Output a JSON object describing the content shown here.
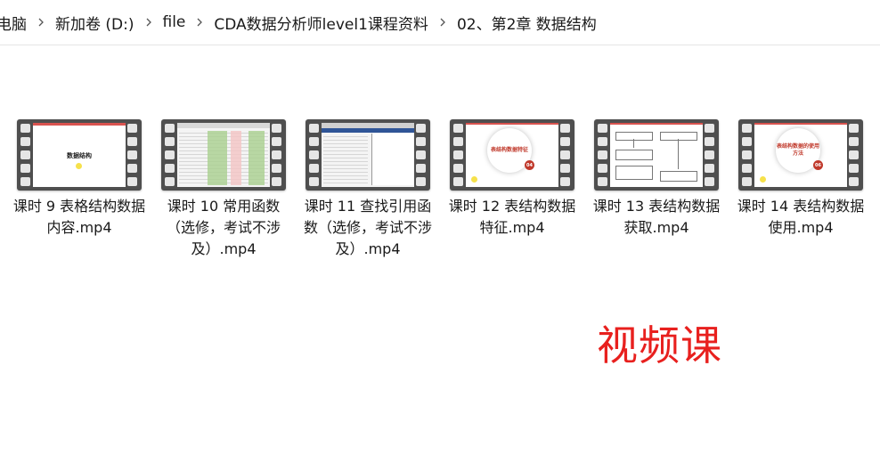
{
  "breadcrumb": [
    "电脑",
    "新加卷 (D:)",
    "file",
    "CDA数据分析师level1课程资料",
    "02、第2章 数据结构"
  ],
  "files": [
    {
      "label": "课时 9  表格结构数据内容.mp4",
      "thumb_text": "数据结构"
    },
    {
      "label": "课时 10  常用函数（选修，考试不涉及）.mp4"
    },
    {
      "label": "课时 11  查找引用函数（选修，考试不涉及）.mp4"
    },
    {
      "label": "课时 12  表结构数据特征.mp4",
      "thumb_text": "表结构数据特征",
      "badge": "04"
    },
    {
      "label": "课时 13  表结构数据获取.mp4"
    },
    {
      "label": "课时 14  表结构数据使用.mp4",
      "thumb_text": "表结构数据的使用方法",
      "badge": "06"
    }
  ],
  "annotation": "视频课",
  "colors": {
    "annotation": "#e8201e",
    "film": "#4f4f4f",
    "accent_red": "#c0392b"
  }
}
